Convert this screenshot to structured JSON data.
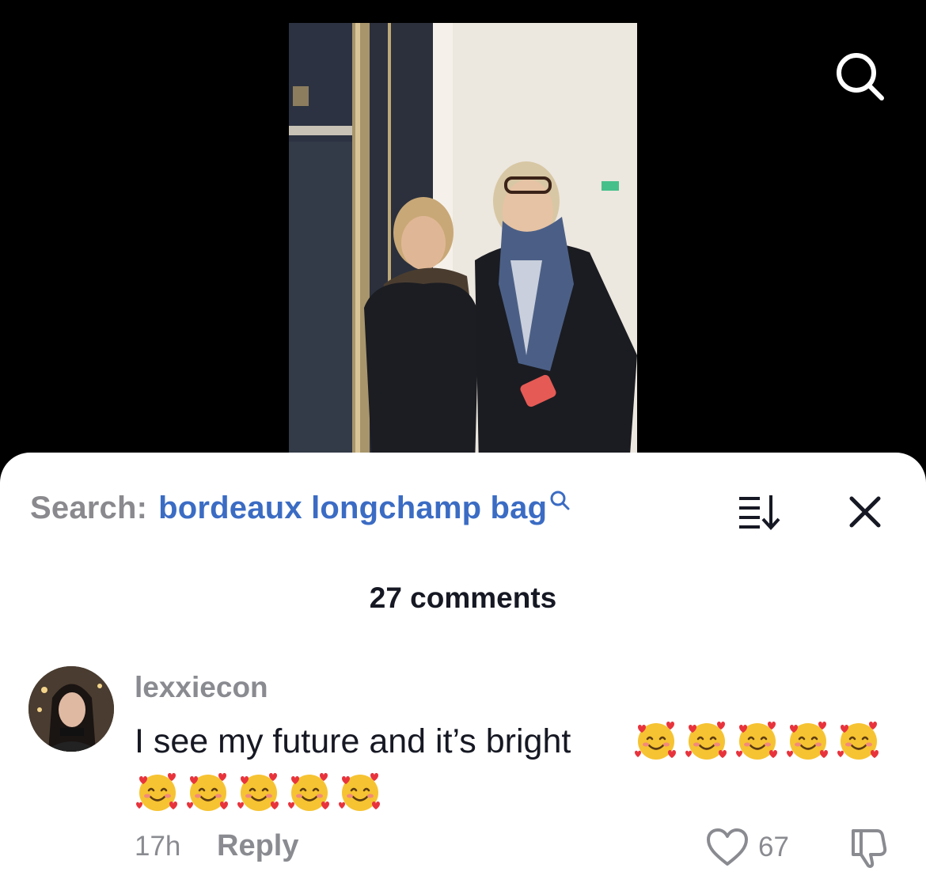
{
  "video": {
    "description_icons": [
      "search-icon"
    ]
  },
  "search": {
    "prefix": "Search:",
    "query": "bordeaux longchamp bag"
  },
  "comments": {
    "count_label": "27 comments",
    "items": [
      {
        "username": "lexxiecon",
        "text": "I see my future and it’s bright",
        "emoji": "🥰",
        "emoji_count": 10,
        "time": "17h",
        "reply_label": "Reply",
        "likes": "67"
      }
    ]
  },
  "colors": {
    "search_query": "#3b6cc4",
    "muted_text": "#8a8b91",
    "primary_text": "#161823",
    "sheet_bg": "#ffffff",
    "page_bg": "#000000"
  }
}
